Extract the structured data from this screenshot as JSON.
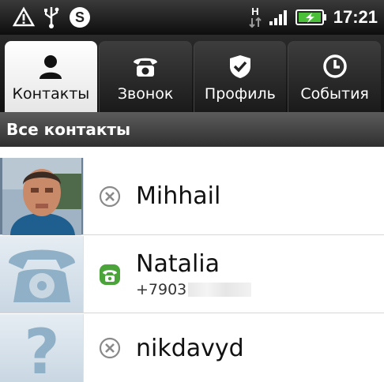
{
  "status_bar": {
    "time": "17:21",
    "left_icons": [
      "warning-icon",
      "usb-icon",
      "skype-icon"
    ],
    "right_icons": [
      "hspa-icon",
      "signal-icon",
      "battery-charging-icon"
    ]
  },
  "tabs": [
    {
      "label": "Контакты",
      "icon": "person-icon",
      "active": true
    },
    {
      "label": "Звонок",
      "icon": "phone-icon",
      "active": false
    },
    {
      "label": "Профиль",
      "icon": "profile-shield-icon",
      "active": false
    },
    {
      "label": "События",
      "icon": "clock-icon",
      "active": false
    }
  ],
  "section": {
    "title": "Все контакты"
  },
  "contacts": [
    {
      "name": "Mihhail",
      "phone": "",
      "status": "offline",
      "avatar": "photo"
    },
    {
      "name": "Natalia",
      "phone": "+7903",
      "status": "online-phone",
      "avatar": "phone"
    },
    {
      "name": "nikdavyd",
      "phone": "",
      "status": "offline",
      "avatar": "unknown"
    }
  ],
  "colors": {
    "online": "#4aa43a",
    "offline_icon": "#8a8a8a",
    "avatar_bg": "#c9d7e3"
  }
}
